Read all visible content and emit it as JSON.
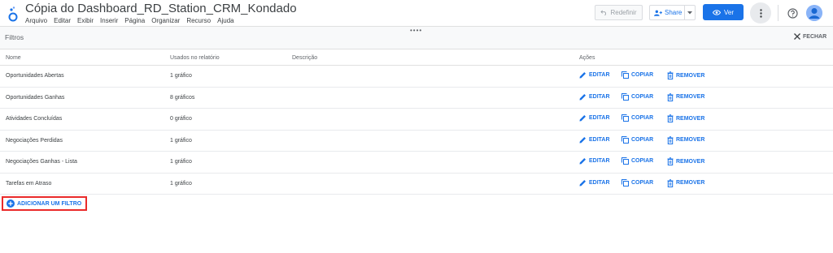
{
  "header": {
    "title": "Cópia do Dashboard_RD_Station_CRM_Kondado",
    "menu": [
      "Arquivo",
      "Editar",
      "Exibir",
      "Inserir",
      "Página",
      "Organizar",
      "Recurso",
      "Ajuda"
    ],
    "reset_label": "Redefinir",
    "share_label": "Share",
    "view_label": "Ver"
  },
  "panel": {
    "title": "Filtros",
    "close_label": "FECHAR",
    "drag_handle": "••••"
  },
  "table": {
    "columns": {
      "name": "Nome",
      "used": "Usados no relatório",
      "description": "Descrição",
      "actions": "Ações"
    },
    "action_labels": {
      "edit": "EDITAR",
      "copy": "COPIAR",
      "remove": "REMOVER"
    },
    "rows": [
      {
        "name": "Oportunidades Abertas",
        "used": "1 gráfico",
        "description": ""
      },
      {
        "name": "Oportunidades Ganhas",
        "used": "8 gráficos",
        "description": ""
      },
      {
        "name": "Atividades Concluídas",
        "used": "0 gráfico",
        "description": ""
      },
      {
        "name": "Negociações Perdidas",
        "used": "1 gráfico",
        "description": ""
      },
      {
        "name": "Negociações Ganhas - Lista",
        "used": "1 gráfico",
        "description": ""
      },
      {
        "name": "Tarefas em Atraso",
        "used": "1 gráfico",
        "description": ""
      }
    ]
  },
  "add_filter_label": "ADICIONAR UM FILTRO",
  "colors": {
    "accent": "#1a73e8",
    "highlight_border": "#ea2a2a",
    "text": "#3c4043"
  },
  "icons": {
    "logo": "data-studio-logo",
    "reset": "undo-icon",
    "share": "person-add-icon",
    "view": "eye-icon",
    "more": "more-vert-icon",
    "help": "help-icon",
    "close": "close-icon",
    "edit": "pencil-icon",
    "copy": "copy-icon",
    "remove": "trash-icon",
    "add": "add-circle-icon"
  }
}
